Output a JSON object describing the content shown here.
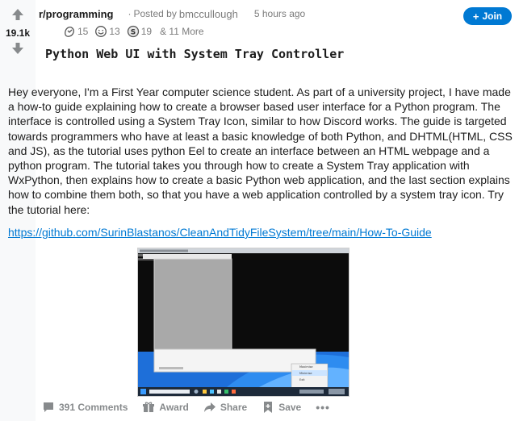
{
  "vote": {
    "count": "19.1k"
  },
  "header": {
    "subreddit": "r/programming",
    "posted_by_prefix": "Posted by",
    "username": "bmccullough",
    "timestamp": "5 hours ago"
  },
  "join_button": {
    "label": "Join",
    "plus": "+"
  },
  "awards": {
    "items": [
      {
        "icon": "hand-award-icon",
        "count": "15"
      },
      {
        "icon": "laugh-award-icon",
        "count": "13"
      },
      {
        "icon": "silver-award-icon",
        "count": "19"
      }
    ],
    "more": "& 11 More"
  },
  "post": {
    "title": "Python Web UI with System Tray Controller",
    "body": "Hey everyone, I'm a First Year computer science student. As part of a university project, I have made a how-to guide explaining how to create a browser based user interface for a Python program. The interface is controlled using a System Tray Icon, similar to how Discord works. The guide is targeted towards programmers who have at least a basic knowledge of both Python, and DHTML(HTML, CSS and JS), as the tutorial uses python Eel to create an interface between an HTML webpage and a python program. The tutorial takes you through how to create a System Tray application with WxPython, then explains how to create a basic Python web application, and the last section explains how to combine them both, so that you have a web application controlled by a system tray icon. Try the tutorial here:",
    "link": "https://github.com/SurinBlastanos/CleanAndTidyFileSystem/tree/main/How-To-Guide"
  },
  "image": {
    "tray_menu_items": [
      "Maximise",
      "Minimise",
      "Exit"
    ]
  },
  "actions": {
    "comments": "391 Comments",
    "award": "Award",
    "share": "Share",
    "save": "Save",
    "more": "•••"
  }
}
